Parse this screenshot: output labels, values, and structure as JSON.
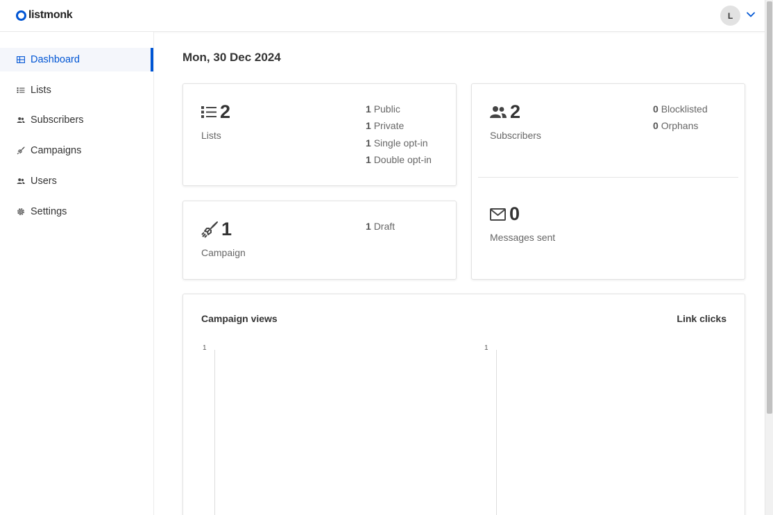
{
  "app": {
    "logo_text": "listmonk"
  },
  "header": {
    "avatar_initial": "L"
  },
  "sidebar": {
    "items": [
      {
        "label": "Dashboard",
        "icon": "grid-icon",
        "active": true
      },
      {
        "label": "Lists",
        "icon": "list-icon"
      },
      {
        "label": "Subscribers",
        "icon": "users-icon"
      },
      {
        "label": "Campaigns",
        "icon": "rocket-icon"
      },
      {
        "label": "Users",
        "icon": "users-icon"
      },
      {
        "label": "Settings",
        "icon": "gear-icon"
      }
    ]
  },
  "dashboard": {
    "date": "Mon, 30 Dec 2024",
    "lists": {
      "count": "2",
      "label": "Lists",
      "stats": [
        {
          "value": "1",
          "label": "Public"
        },
        {
          "value": "1",
          "label": "Private"
        },
        {
          "value": "1",
          "label": "Single opt-in"
        },
        {
          "value": "1",
          "label": "Double opt-in"
        }
      ]
    },
    "subscribers": {
      "count": "2",
      "label": "Subscribers",
      "stats": [
        {
          "value": "0",
          "label": "Blocklisted"
        },
        {
          "value": "0",
          "label": "Orphans"
        }
      ]
    },
    "campaigns": {
      "count": "1",
      "label": "Campaign",
      "stats": [
        {
          "value": "1",
          "label": "Draft"
        }
      ]
    },
    "messages": {
      "count": "0",
      "label": "Messages sent"
    },
    "charts": {
      "views_title": "Campaign views",
      "clicks_title": "Link clicks"
    }
  },
  "chart_data": [
    {
      "type": "line",
      "title": "Campaign views",
      "ylim": [
        0,
        1
      ],
      "yticks": [
        "1"
      ],
      "series": []
    },
    {
      "type": "line",
      "title": "Link clicks",
      "ylim": [
        0,
        1
      ],
      "yticks": [
        "1"
      ],
      "series": []
    }
  ],
  "colors": {
    "accent": "#0055d4",
    "text": "#333333",
    "muted": "#666666"
  }
}
